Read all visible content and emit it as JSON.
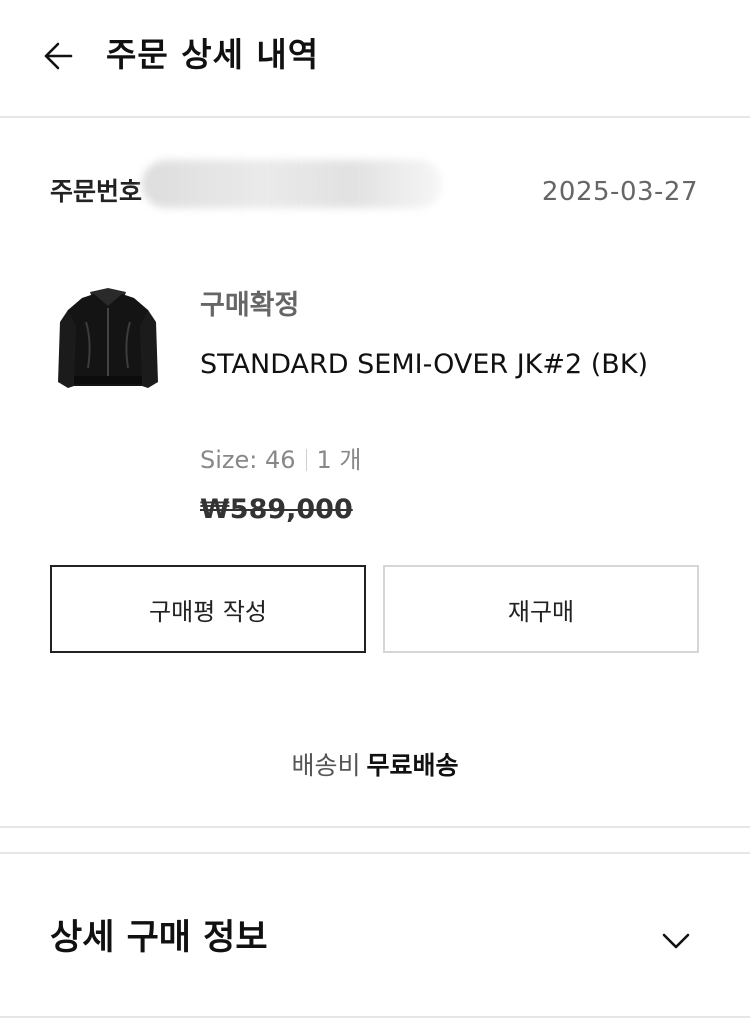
{
  "header": {
    "back_icon": "arrow-left-icon",
    "title": "주문 상세 내역"
  },
  "order": {
    "number_label": "주문번호",
    "date": "2025-03-27"
  },
  "product": {
    "status": "구매확정",
    "name": "STANDARD SEMI-OVER JK#2 (BK)",
    "size": "Size: 46",
    "quantity": "1 개",
    "price": "₩589,000",
    "thumbnail_icon": "leather-jacket-image"
  },
  "actions": {
    "review_label": "구매평 작성",
    "rebuy_label": "재구매"
  },
  "shipping": {
    "label": "배송비",
    "value": "무료배송"
  },
  "details": {
    "title": "상세 구매 정보",
    "toggle_icon": "chevron-down-icon"
  },
  "colors": {
    "text_primary": "#111111",
    "text_secondary": "#666666",
    "border_dark": "#222222",
    "border_light": "#d6d6d6",
    "divider": "#e6e6e6"
  }
}
